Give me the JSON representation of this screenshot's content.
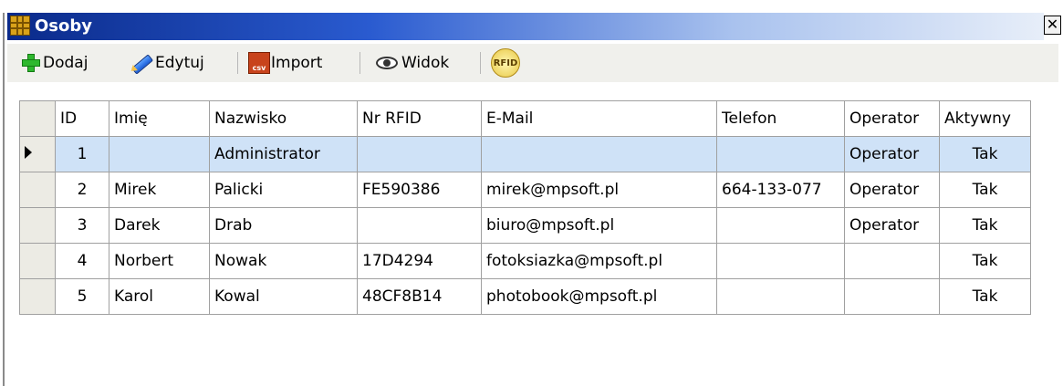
{
  "window": {
    "title": "Osoby",
    "close_label": "✕"
  },
  "toolbar": {
    "add_label": "Dodaj",
    "edit_label": "Edytuj",
    "import_label": "Import",
    "view_label": "Widok",
    "rfid_label": "RFID",
    "csv_icon_text": "csv"
  },
  "grid": {
    "columns": [
      "ID",
      "Imię",
      "Nazwisko",
      "Nr RFID",
      "E-Mail",
      "Telefon",
      "Operator",
      "Aktywny"
    ],
    "rows": [
      {
        "id": "1",
        "first_name": "",
        "last_name": "Administrator",
        "rfid": "",
        "email": "",
        "phone": "",
        "operator": "Operator",
        "active": "Tak",
        "selected": true
      },
      {
        "id": "2",
        "first_name": "Mirek",
        "last_name": "Palicki",
        "rfid": "FE590386",
        "email": "mirek@mpsoft.pl",
        "phone": "664-133-077",
        "operator": "Operator",
        "active": "Tak",
        "selected": false
      },
      {
        "id": "3",
        "first_name": "Darek",
        "last_name": "Drab",
        "rfid": "",
        "email": "biuro@mpsoft.pl",
        "phone": "",
        "operator": "Operator",
        "active": "Tak",
        "selected": false
      },
      {
        "id": "4",
        "first_name": "Norbert",
        "last_name": "Nowak",
        "rfid": "17D4294",
        "email": "fotoksiazka@mpsoft.pl",
        "phone": "",
        "operator": "",
        "active": "Tak",
        "selected": false
      },
      {
        "id": "5",
        "first_name": "Karol",
        "last_name": "Kowal",
        "rfid": "48CF8B14",
        "email": "photobook@mpsoft.pl",
        "phone": "",
        "operator": "",
        "active": "Tak",
        "selected": false
      }
    ]
  },
  "colors": {
    "titlebar_start": "#0a2a8a",
    "toolbar_bg": "#f0f0ec",
    "selected_row": "#cfe2f7",
    "grid_border": "#a0a0a0"
  }
}
